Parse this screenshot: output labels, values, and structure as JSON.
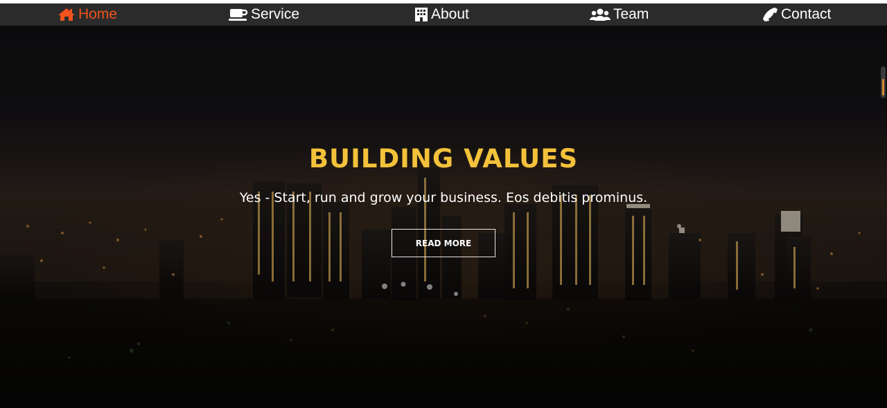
{
  "nav": {
    "items": [
      {
        "label": "Home",
        "icon": "home-icon",
        "active": true
      },
      {
        "label": "Service",
        "icon": "coffee-icon",
        "active": false
      },
      {
        "label": "About",
        "icon": "building-icon",
        "active": false
      },
      {
        "label": "Team",
        "icon": "users-icon",
        "active": false
      },
      {
        "label": "Contact",
        "icon": "phone-icon",
        "active": false
      }
    ],
    "active_color": "#f2531d",
    "text_color": "#ffffff",
    "background": "#2b2b2b"
  },
  "hero": {
    "title": "BUILDING VALUES",
    "subtitle": "Yes - Start, run and grow your business. Eos debitis prominus.",
    "button_label": "READ MORE",
    "title_color": "#f3c13a"
  },
  "scroll_indicator": {
    "accent_color": "#d7892e"
  }
}
